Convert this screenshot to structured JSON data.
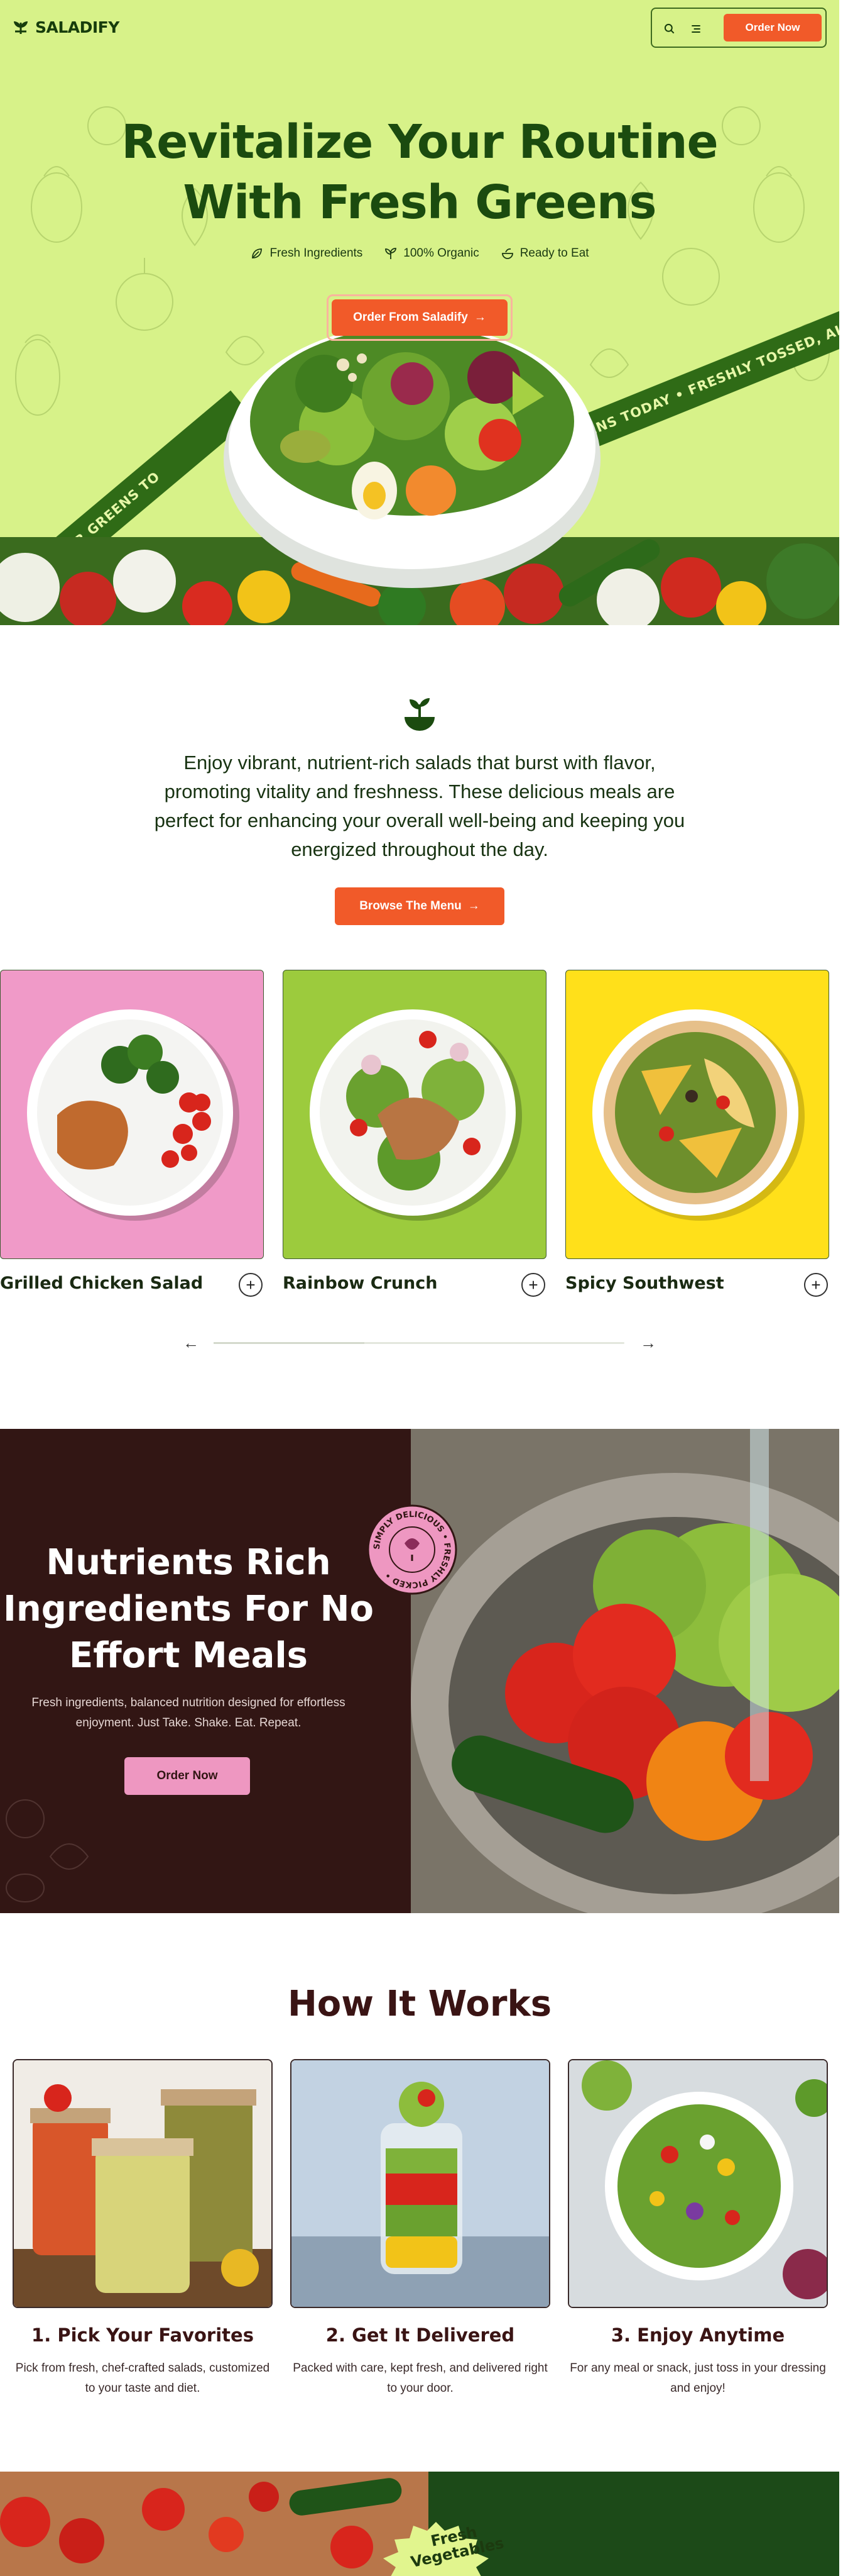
{
  "brand": {
    "name": "SALADIFY"
  },
  "nav": {
    "order_label": "Order Now",
    "search_icon": "search-icon",
    "menu_icon": "menu-lines-icon"
  },
  "hero": {
    "title_line1": "Revitalize Your Routine",
    "title_line2": "With Fresh Greens",
    "features": [
      "Fresh Ingredients",
      "100% Organic",
      "Ready to Eat"
    ],
    "cta_label": "Order From Saladify",
    "ribbon_left": "ELICIOUS ORDER YOUR GREENS TO",
    "ribbon_right": "REENS TODAY • FRESHLY TOSSED, ALWAYS DE"
  },
  "intro": {
    "text": "Enjoy vibrant, nutrient-rich salads that burst with flavor, promoting vitality and freshness. These delicious meals are perfect for enhancing your overall well-being and keeping you energized throughout the day.",
    "button_label": "Browse The Menu"
  },
  "menu": {
    "items": [
      {
        "name": "Grilled Chicken Salad",
        "bg": "#f09ac8"
      },
      {
        "name": "Rainbow Crunch",
        "bg": "#9ccb3d"
      },
      {
        "name": "Spicy Southwest",
        "bg": "#ffe01a"
      }
    ],
    "prev_label": "←",
    "next_label": "→"
  },
  "nutrients": {
    "title": "Nutrients Rich Ingredients For No Effort Meals",
    "description": "Fresh ingredients, balanced nutrition designed for effortless enjoyment. Just Take. Shake. Eat. Repeat.",
    "button_label": "Order Now",
    "badge_text": "SIMPLY DELICIOUS • FRESHLY PICKED •"
  },
  "how": {
    "title": "How It Works",
    "steps": [
      {
        "title": "1. Pick Your Favorites",
        "desc": "Pick from fresh, chef-crafted salads, customized to your taste and diet."
      },
      {
        "title": "2. Get It Delivered",
        "desc": "Packed with care, kept fresh, and delivered right to your door."
      },
      {
        "title": "3. Enjoy Anytime",
        "desc": "For any meal or snack, just toss in your dressing and enjoy!"
      }
    ]
  },
  "bottom": {
    "badge_line1": "Fresh",
    "badge_line2": "Vegetables"
  },
  "colors": {
    "accent": "#f15a29",
    "hero_bg": "#d7f289",
    "dark_green": "#1b4b0f",
    "maroon": "#321614",
    "pink": "#ee97c1"
  }
}
